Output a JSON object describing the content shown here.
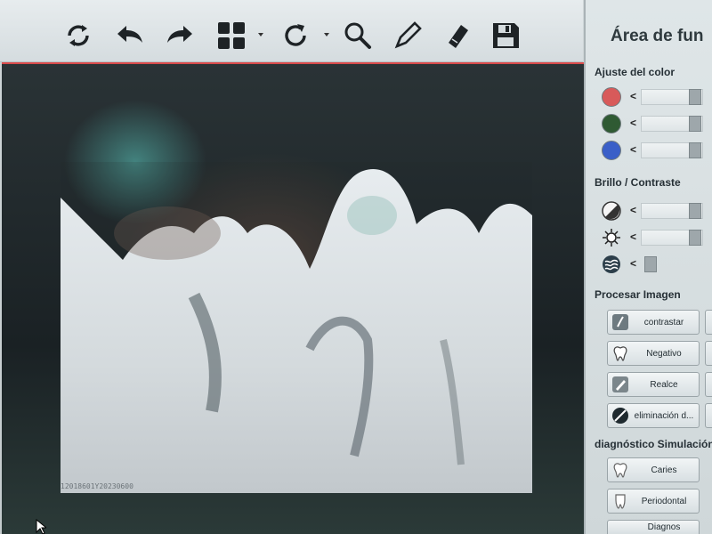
{
  "toolbar": {
    "buttons": [
      {
        "name": "refresh",
        "icon": "refresh-icon"
      },
      {
        "name": "undo",
        "icon": "undo-icon"
      },
      {
        "name": "redo",
        "icon": "redo-icon"
      },
      {
        "name": "layout-grid",
        "icon": "grid-icon"
      },
      {
        "name": "rotate",
        "icon": "rotate-icon"
      },
      {
        "name": "zoom",
        "icon": "magnifier-icon"
      },
      {
        "name": "measure",
        "icon": "pen-icon"
      },
      {
        "name": "eraser",
        "icon": "eraser-icon"
      },
      {
        "name": "save",
        "icon": "floppy-icon"
      }
    ]
  },
  "viewer": {
    "image_id": "12018601Y20230600"
  },
  "panel": {
    "title": "Área de fun",
    "color_section": {
      "title": "Ajuste del color",
      "rows": [
        {
          "name": "red",
          "color": "#d85a5a",
          "arrow": "<"
        },
        {
          "name": "green",
          "color": "#2f5a33",
          "arrow": "<"
        },
        {
          "name": "blue",
          "color": "#3a5fc8",
          "arrow": "<"
        }
      ]
    },
    "brightness_section": {
      "title": "Brillo / Contraste",
      "rows": [
        {
          "name": "contrast",
          "icon": "contrast-icon",
          "arrow": "<"
        },
        {
          "name": "brightness",
          "icon": "sun-icon",
          "arrow": "<"
        },
        {
          "name": "gamma",
          "icon": "waves-icon",
          "arrow": "<"
        }
      ]
    },
    "process_section": {
      "title": "Procesar Imagen",
      "buttons": [
        {
          "label": "contrastar",
          "icon": "contrast-tool-icon"
        },
        {
          "label": "Negativo",
          "icon": "tooth-icon"
        },
        {
          "label": "Realce",
          "icon": "brush-icon"
        },
        {
          "label": "eliminación d...",
          "icon": "noise-removal-icon"
        }
      ]
    },
    "diagnosis_section": {
      "title": "diagnóstico Simulación",
      "buttons": [
        {
          "label": "Caries",
          "icon": "tooth-icon"
        },
        {
          "label": "Periodontal",
          "icon": "tooth-root-icon"
        },
        {
          "label": "Diagnos",
          "icon": "tooth-icon"
        }
      ]
    }
  }
}
